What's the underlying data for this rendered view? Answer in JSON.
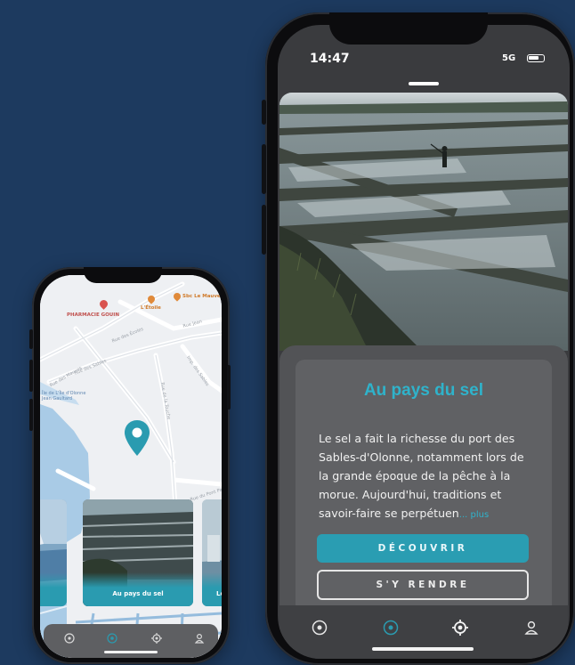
{
  "small_phone": {
    "map": {
      "pois": [
        {
          "label": "PHARMACIE GOUIN",
          "color": "red"
        },
        {
          "label": "L'Étoile",
          "color": "orange"
        },
        {
          "label": "Sbc Le Mauve",
          "color": "orange"
        }
      ],
      "streets": [
        "Rue des Écoles",
        "Rue des Sables",
        "Rue des Mauves",
        "Rue de la Touche",
        "Imp. des Sables",
        "Rue du Pont Paul",
        "Rue Jean"
      ],
      "area_label": "Île de L'Île d'Olonne\nJean Gaultard",
      "marker_icon": "location-pin-icon",
      "marker_color": "#2a9bb0"
    },
    "cards": [
      {
        "label": "Au pays du sel"
      },
      {
        "label": "Le"
      }
    ],
    "tabs": [
      "discover-icon",
      "map-icon",
      "locate-icon",
      "profile-icon"
    ]
  },
  "large_phone": {
    "status": {
      "time": "14:47",
      "network": "5G"
    },
    "detail": {
      "title": "Au pays du sel",
      "description": "Le sel a fait la richesse du port des Sables-d'Olonne, notamment lors de la grande époque de la pêche à la morue. Aujourd'hui, traditions et savoir-faire se perpétuen",
      "more": "... plus",
      "discover_button": "DÉCOUVRIR",
      "go_button": "S'Y RENDRE"
    },
    "tabs": [
      "discover-icon",
      "map-icon",
      "locate-icon",
      "profile-icon"
    ],
    "colors": {
      "accent": "#2fb3cb",
      "button": "#2a9db2",
      "sheet": "#525356",
      "background": "#1d3a5f"
    }
  }
}
